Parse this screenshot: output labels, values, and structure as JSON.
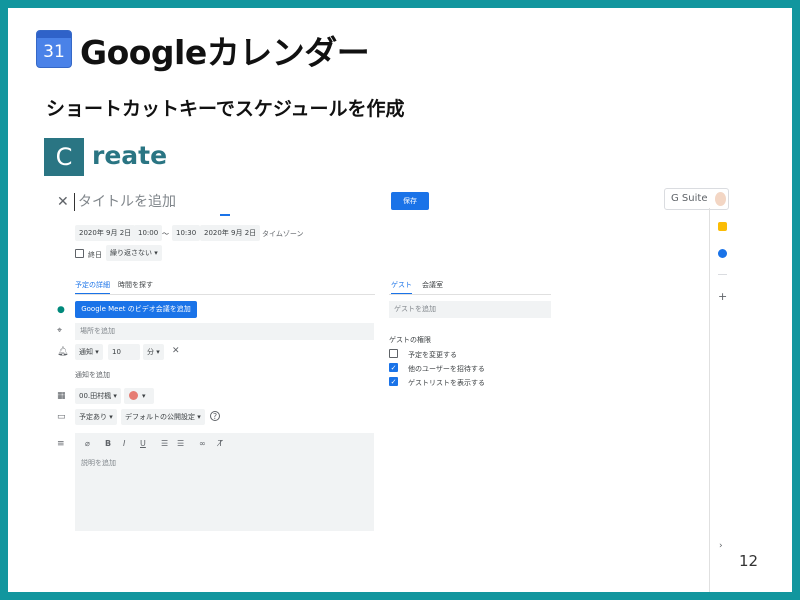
{
  "header": {
    "calendar_icon_number": "31",
    "title": "Googleカレンダー",
    "subtitle": "ショートカットキーでスケジュールを作成",
    "create_letter": "C",
    "create_rest": "reate"
  },
  "event_editor": {
    "title_placeholder": "タイトルを追加",
    "save_label": "保存",
    "start_date": "2020年 9月 2日",
    "start_time": "10:00",
    "tilde": "〜",
    "end_time": "10:30",
    "end_date": "2020年 9月 2日",
    "timezone_label": "タイムゾーン",
    "all_day_label": "終日",
    "repeat_value": "繰り返さない",
    "tabs": [
      "予定の詳細",
      "時間を探す"
    ],
    "meet_button": "Google Meet のビデオ会議を追加",
    "location_placeholder": "場所を追加",
    "notification_type": "通知",
    "notification_value": "10",
    "notification_unit": "分",
    "add_notification": "通知を追加",
    "calendar_owner": "00.田村楓",
    "busy_status": "予定あり",
    "visibility": "デフォルトの公開設定",
    "description_placeholder": "説明を追加"
  },
  "guest_panel": {
    "tabs": [
      "ゲスト",
      "会議室"
    ],
    "guest_placeholder": "ゲストを追加",
    "permissions_title": "ゲストの権限",
    "permissions": [
      {
        "label": "予定を変更する",
        "checked": false
      },
      {
        "label": "他のユーザーを招待する",
        "checked": true
      },
      {
        "label": "ゲストリストを表示する",
        "checked": true
      }
    ]
  },
  "topbar": {
    "gsuite_label": "G Suite"
  },
  "page_number": "12",
  "colors": {
    "frame": "#12969e",
    "accent_blue": "#1a73e8",
    "create_teal": "#2a7583",
    "event_color": "#e67c73"
  }
}
